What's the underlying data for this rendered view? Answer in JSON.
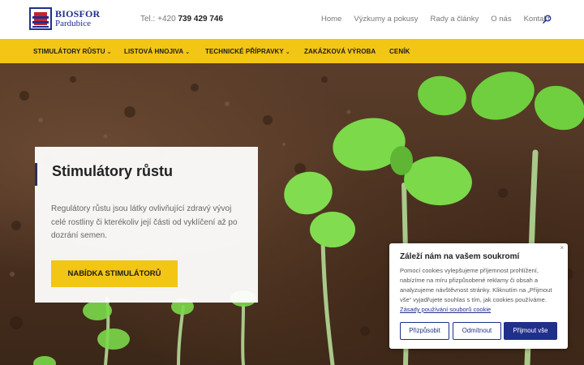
{
  "header": {
    "logo": {
      "line1": "BIOSFOR",
      "line2": "Pardubice"
    },
    "phone": {
      "label": "Tel.: +420",
      "number": "739 429 746"
    },
    "nav": [
      "Home",
      "Výzkumy a pokusy",
      "Rady a články",
      "O nás",
      "Kontakt"
    ]
  },
  "menu": {
    "items": [
      {
        "label": "STIMULÁTORY RŮSTU",
        "dropdown": true
      },
      {
        "label": "LISTOVÁ HNOJIVA",
        "dropdown": true
      },
      {
        "label": "TECHNICKÉ PŘÍPRAVKY",
        "dropdown": true
      },
      {
        "label": "ZAKÁZKOVÁ VÝROBA",
        "dropdown": false
      },
      {
        "label": "CENÍK",
        "dropdown": false
      }
    ]
  },
  "hero": {
    "title": "Stimulátory růstu",
    "text": "Regulátory růstu jsou látky ovlivňující zdravý vývoj celé rostliny či kterékoliv její části od vyklíčení až po dozrání semen.",
    "button": "NABÍDKA STIMULÁTORŮ"
  },
  "cookie": {
    "close": "×",
    "title": "Záleží nám na vašem soukromí",
    "body": "Pomocí cookies vylepšujeme příjemnost prohlížení, nabízíme na míru přizpůsobené reklamy či obsah a analyzujeme návštěvnost stránky. Kliknutím na „Přijmout vše“ vyjadřujete souhlas s tím, jak cookies používáme.",
    "link": "Zásady používání souborů cookie",
    "buttons": {
      "customize": "Přizpůsobit",
      "reject": "Odmítnout",
      "accept": "Přijmout vše"
    }
  },
  "colors": {
    "accent": "#f3c515",
    "brand": "#1f2f8a",
    "logo_red": "#c8232c"
  },
  "icons": {
    "search": "search-icon",
    "dropdown": "chevron-down-icon"
  }
}
